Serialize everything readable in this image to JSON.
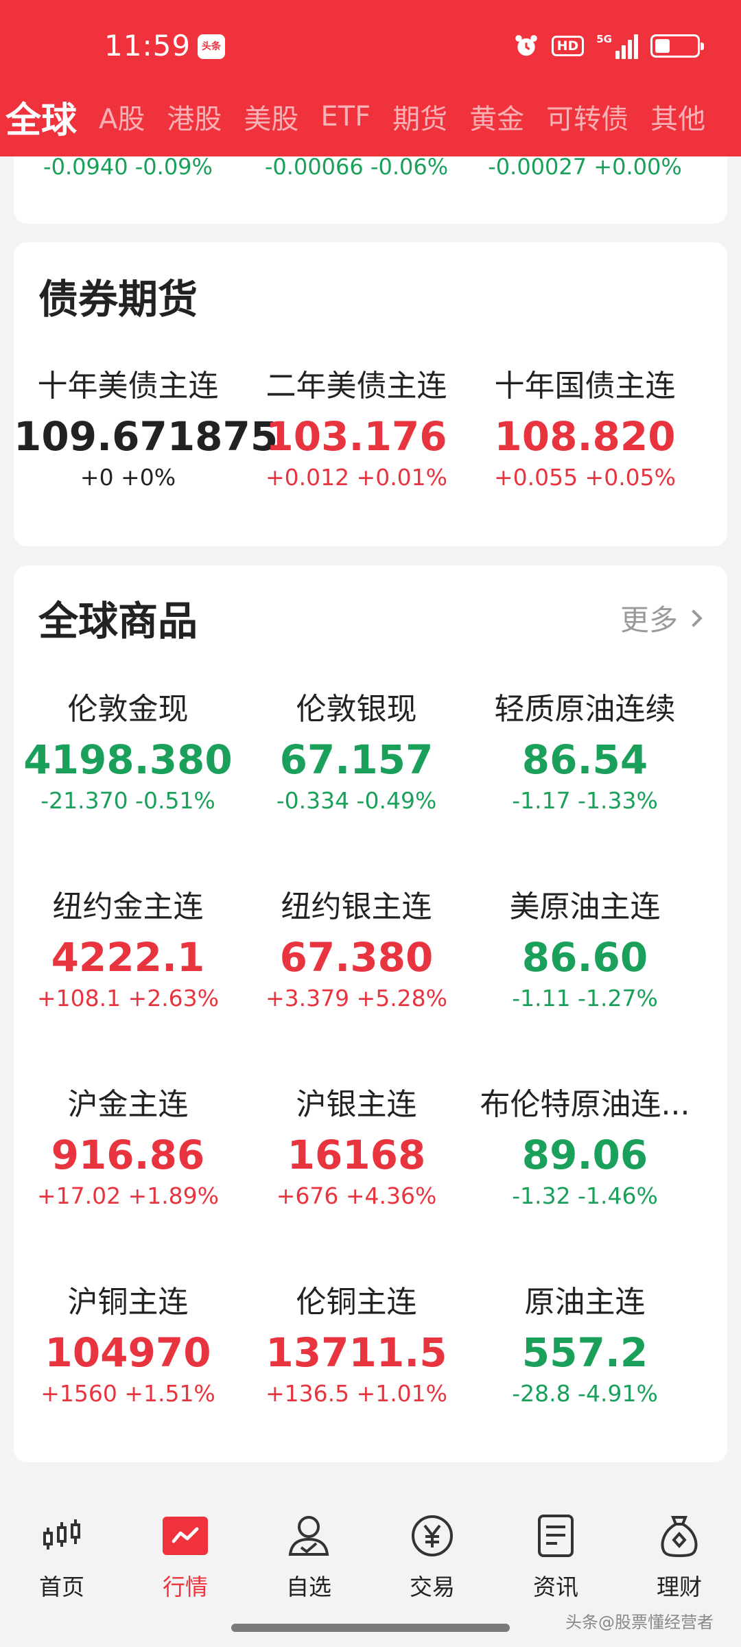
{
  "status": {
    "time": "11:59",
    "badge": "头条",
    "hd": "HD",
    "network": "5G",
    "battery_level": 0.35
  },
  "tabs": [
    {
      "label": "全球",
      "active": true
    },
    {
      "label": "A股"
    },
    {
      "label": "港股"
    },
    {
      "label": "美股"
    },
    {
      "label": "ETF"
    },
    {
      "label": "期货"
    },
    {
      "label": "黄金"
    },
    {
      "label": "可转债"
    },
    {
      "label": "其他"
    }
  ],
  "top_card": {
    "changes": [
      "-0.0940 -0.09%",
      "-0.00066 -0.06%",
      "-0.00027 +0.00%"
    ]
  },
  "bond": {
    "title": "债券期货",
    "items": [
      {
        "name": "十年美债主连",
        "price": "109.671875",
        "delta": "+0 +0%",
        "dir": "flat"
      },
      {
        "name": "二年美债主连",
        "price": "103.176",
        "delta": "+0.012 +0.01%",
        "dir": "up"
      },
      {
        "name": "十年国债主连",
        "price": "108.820",
        "delta": "+0.055 +0.05%",
        "dir": "up"
      }
    ]
  },
  "commodities": {
    "title": "全球商品",
    "more": "更多",
    "items": [
      {
        "name": "伦敦金现",
        "price": "4198.380",
        "delta": "-21.370 -0.51%",
        "dir": "down"
      },
      {
        "name": "伦敦银现",
        "price": "67.157",
        "delta": "-0.334 -0.49%",
        "dir": "down"
      },
      {
        "name": "轻质原油连续",
        "price": "86.54",
        "delta": "-1.17 -1.33%",
        "dir": "down"
      },
      {
        "name": "纽约金主连",
        "price": "4222.1",
        "delta": "+108.1 +2.63%",
        "dir": "up"
      },
      {
        "name": "纽约银主连",
        "price": "67.380",
        "delta": "+3.379 +5.28%",
        "dir": "up"
      },
      {
        "name": "美原油主连",
        "price": "86.60",
        "delta": "-1.11 -1.27%",
        "dir": "down"
      },
      {
        "name": "沪金主连",
        "price": "916.86",
        "delta": "+17.02 +1.89%",
        "dir": "up"
      },
      {
        "name": "沪银主连",
        "price": "16168",
        "delta": "+676 +4.36%",
        "dir": "up"
      },
      {
        "name": "布伦特原油连...",
        "price": "89.06",
        "delta": "-1.32 -1.46%",
        "dir": "down"
      },
      {
        "name": "沪铜主连",
        "price": "104970",
        "delta": "+1560 +1.51%",
        "dir": "up"
      },
      {
        "name": "伦铜主连",
        "price": "13711.5",
        "delta": "+136.5 +1.01%",
        "dir": "up"
      },
      {
        "name": "原油主连",
        "price": "557.2",
        "delta": "-28.8 -4.91%",
        "dir": "down"
      }
    ]
  },
  "nav": [
    {
      "label": "首页",
      "icon": "candlestick-icon"
    },
    {
      "label": "行情",
      "icon": "market-chart-icon",
      "active": true
    },
    {
      "label": "自选",
      "icon": "person-check-icon"
    },
    {
      "label": "交易",
      "icon": "yuan-coin-icon"
    },
    {
      "label": "资讯",
      "icon": "document-icon"
    },
    {
      "label": "理财",
      "icon": "money-bag-icon"
    }
  ],
  "watermark": "头条@股票懂经营者"
}
